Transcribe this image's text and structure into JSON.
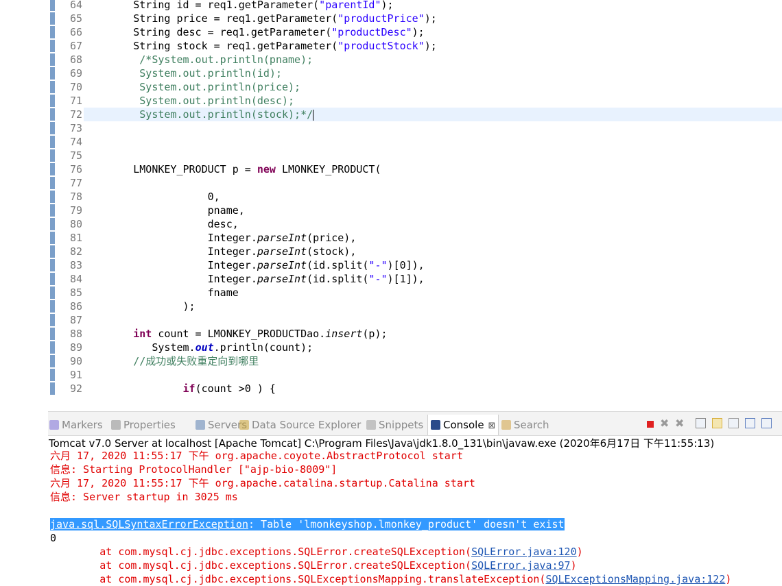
{
  "editor": {
    "lines": [
      {
        "no": "64",
        "segments": [
          {
            "t": "        String id = req1.getParameter("
          },
          {
            "t": "\"parentId\"",
            "c": "str"
          },
          {
            "t": ");"
          }
        ]
      },
      {
        "no": "65",
        "segments": [
          {
            "t": "        String price = req1.getParameter("
          },
          {
            "t": "\"productPrice\"",
            "c": "str"
          },
          {
            "t": ");"
          }
        ]
      },
      {
        "no": "66",
        "segments": [
          {
            "t": "        String desc = req1.getParameter("
          },
          {
            "t": "\"productDesc\"",
            "c": "str"
          },
          {
            "t": ");"
          }
        ]
      },
      {
        "no": "67",
        "segments": [
          {
            "t": "        String stock = req1.getParameter("
          },
          {
            "t": "\"productStock\"",
            "c": "str"
          },
          {
            "t": ");"
          }
        ]
      },
      {
        "no": "68",
        "segments": [
          {
            "t": "         /*System.out.println(pname);",
            "c": "cmt"
          }
        ]
      },
      {
        "no": "69",
        "segments": [
          {
            "t": "         System.out.println(id);",
            "c": "cmt"
          }
        ]
      },
      {
        "no": "70",
        "segments": [
          {
            "t": "         System.out.println(price);",
            "c": "cmt"
          }
        ]
      },
      {
        "no": "71",
        "segments": [
          {
            "t": "         System.out.println(desc);",
            "c": "cmt"
          }
        ]
      },
      {
        "no": "72",
        "current": true,
        "cursor": true,
        "segments": [
          {
            "t": "         System.out.println(stock);*/",
            "c": "cmt"
          }
        ]
      },
      {
        "no": "73",
        "segments": []
      },
      {
        "no": "74",
        "segments": []
      },
      {
        "no": "75",
        "segments": []
      },
      {
        "no": "76",
        "segments": [
          {
            "t": "        LMONKEY_PRODUCT p = "
          },
          {
            "t": "new",
            "c": "kw"
          },
          {
            "t": " LMONKEY_PRODUCT("
          }
        ]
      },
      {
        "no": "77",
        "segments": []
      },
      {
        "no": "78",
        "segments": [
          {
            "t": "                    0,"
          }
        ]
      },
      {
        "no": "79",
        "segments": [
          {
            "t": "                    pname,"
          }
        ]
      },
      {
        "no": "80",
        "segments": [
          {
            "t": "                    desc,"
          }
        ]
      },
      {
        "no": "81",
        "segments": [
          {
            "t": "                    Integer."
          },
          {
            "t": "parseInt",
            "c": "it"
          },
          {
            "t": "(price),"
          }
        ]
      },
      {
        "no": "82",
        "segments": [
          {
            "t": "                    Integer."
          },
          {
            "t": "parseInt",
            "c": "it"
          },
          {
            "t": "(stock),"
          }
        ]
      },
      {
        "no": "83",
        "segments": [
          {
            "t": "                    Integer."
          },
          {
            "t": "parseInt",
            "c": "it"
          },
          {
            "t": "(id.split("
          },
          {
            "t": "\"-\"",
            "c": "str"
          },
          {
            "t": ")[0]),"
          }
        ]
      },
      {
        "no": "84",
        "segments": [
          {
            "t": "                    Integer."
          },
          {
            "t": "parseInt",
            "c": "it"
          },
          {
            "t": "(id.split("
          },
          {
            "t": "\"-\"",
            "c": "str"
          },
          {
            "t": ")[1]),"
          }
        ]
      },
      {
        "no": "85",
        "segments": [
          {
            "t": "                    fname"
          }
        ]
      },
      {
        "no": "86",
        "segments": [
          {
            "t": "                );"
          }
        ]
      },
      {
        "no": "87",
        "segments": []
      },
      {
        "no": "88",
        "segments": [
          {
            "t": "        "
          },
          {
            "t": "int",
            "c": "kw"
          },
          {
            "t": " count = LMONKEY_PRODUCTDao."
          },
          {
            "t": "insert",
            "c": "it"
          },
          {
            "t": "(p);"
          }
        ]
      },
      {
        "no": "89",
        "segments": [
          {
            "t": "           System."
          },
          {
            "t": "out",
            "c": "fld"
          },
          {
            "t": ".println(count);"
          }
        ]
      },
      {
        "no": "90",
        "segments": [
          {
            "t": "        //成功或失败重定向到哪里",
            "c": "cmt"
          }
        ]
      },
      {
        "no": "91",
        "segments": []
      },
      {
        "no": "92",
        "segments": [
          {
            "t": "                "
          },
          {
            "t": "if",
            "c": "kw"
          },
          {
            "t": "(count >0 ) {"
          }
        ]
      }
    ],
    "scroll_left_glyph": "<"
  },
  "tabs": [
    {
      "label": "Markers",
      "icon": "markers-icon",
      "color": "#7a6bd6"
    },
    {
      "label": "Properties",
      "icon": "properties-icon",
      "color": "#8a8a8a"
    },
    {
      "label": "Servers",
      "icon": "servers-icon",
      "color": "#5b7fb0"
    },
    {
      "label": "Data Source Explorer",
      "icon": "data-source-icon",
      "color": "#c8a030"
    },
    {
      "label": "Snippets",
      "icon": "snippets-icon",
      "color": "#9a9a9a"
    },
    {
      "label": "Console",
      "icon": "console-icon",
      "active": true,
      "close": "⊠",
      "color": "#2a4a8a"
    },
    {
      "label": "Search",
      "icon": "search-icon",
      "color": "#d0a040"
    }
  ],
  "console": {
    "title": "Tomcat v7.0 Server at localhost [Apache Tomcat] C:\\Program Files\\Java\\jdk1.8.0_131\\bin\\javaw.exe  (2020年6月17日 下午11:55:13)",
    "lines": [
      {
        "segments": [
          {
            "t": "六月 17, 2020 11:55:17 下午 org.apache.coyote.AbstractProtocol start"
          }
        ]
      },
      {
        "segments": [
          {
            "t": "信息: Starting ProtocolHandler [\"ajp-bio-8009\"]"
          }
        ]
      },
      {
        "segments": [
          {
            "t": "六月 17, 2020 11:55:17 下午 org.apache.catalina.startup.Catalina start"
          }
        ]
      },
      {
        "segments": [
          {
            "t": "信息: Server startup in 3025 ms"
          }
        ]
      },
      {
        "segments": []
      },
      {
        "selected": true,
        "segments": [
          {
            "t": "java.sql.SQLSyntaxErrorException",
            "c": "link"
          },
          {
            "t": ": Table 'lmonkeyshop.lmonkey_product' doesn't exist"
          }
        ]
      },
      {
        "plain": true,
        "segments": [
          {
            "t": "0"
          }
        ]
      },
      {
        "segments": [
          {
            "t": "        at com.mysql.cj.jdbc.exceptions.SQLError.createSQLException("
          },
          {
            "t": "SQLError.java:120",
            "c": "link"
          },
          {
            "t": ")"
          }
        ]
      },
      {
        "segments": [
          {
            "t": "        at com.mysql.cj.jdbc.exceptions.SQLError.createSQLException("
          },
          {
            "t": "SQLError.java:97",
            "c": "link"
          },
          {
            "t": ")"
          }
        ]
      },
      {
        "segments": [
          {
            "t": "        at com.mysql.cj.jdbc.exceptions.SQLExceptionsMapping.translateException("
          },
          {
            "t": "SQLExceptionsMapping.java:122",
            "c": "link"
          },
          {
            "t": ")"
          }
        ]
      }
    ]
  },
  "toolbar_icons": [
    "terminate-icon",
    "remove-launch-icon",
    "remove-all-icon",
    "clear-console-icon",
    "scroll-lock-icon",
    "word-wrap-icon",
    "pin-console-icon",
    "display-console-icon"
  ]
}
